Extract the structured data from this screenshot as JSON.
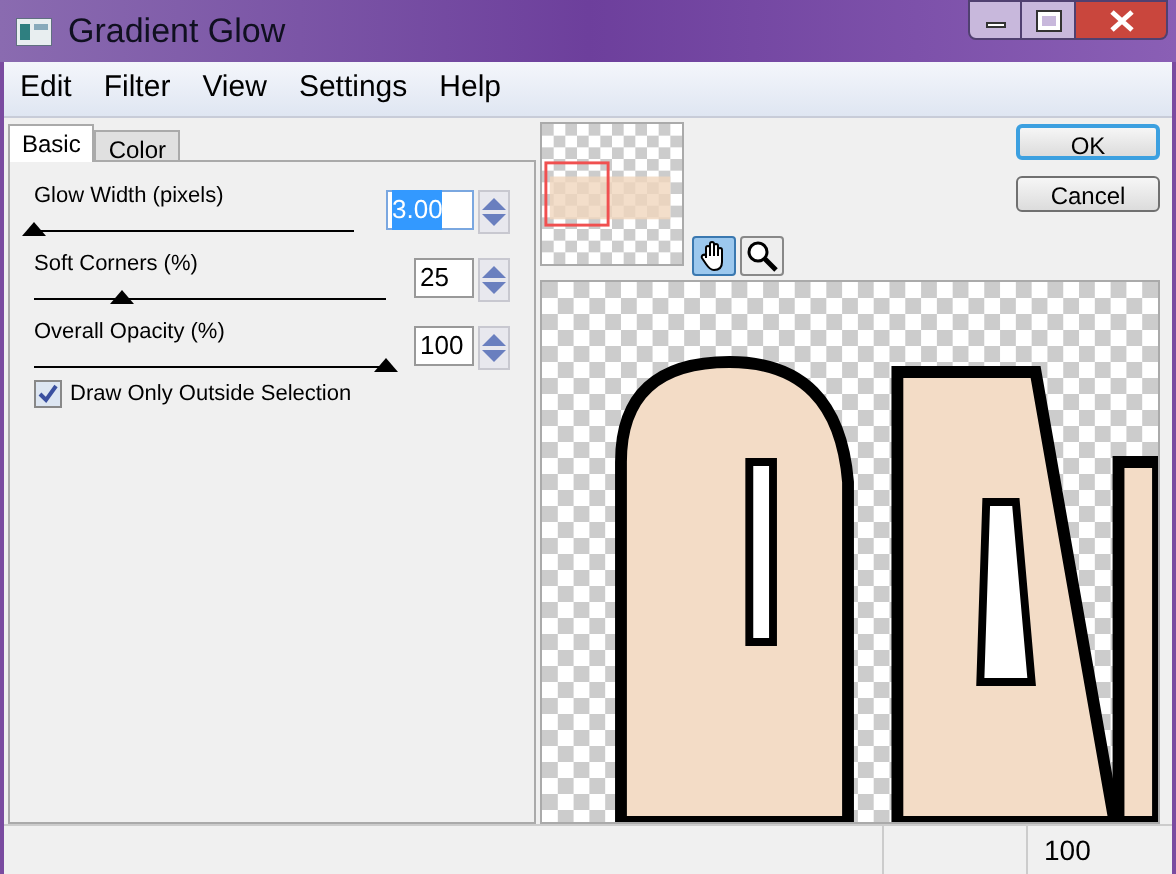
{
  "window": {
    "title": "Gradient Glow"
  },
  "menu": [
    "Edit",
    "Filter",
    "View",
    "Settings",
    "Help"
  ],
  "tabs": [
    {
      "label": "Basic",
      "selected": true
    },
    {
      "label": "Color",
      "selected": false
    }
  ],
  "sliders": [
    {
      "label": "Glow Width (pixels)",
      "value": "3.00",
      "value_selected": true,
      "level": 0
    },
    {
      "label": "Soft Corners (%)",
      "value": "25",
      "value_selected": false,
      "level": 0.25
    },
    {
      "label": "Overall Opacity (%)",
      "value": "100",
      "value_selected": false,
      "level": 1
    }
  ],
  "checkbox": {
    "label": "Draw Only Outside Selection",
    "checked": true
  },
  "tools": [
    {
      "kind": "hand",
      "selected": true
    },
    {
      "kind": "zoom",
      "selected": false
    }
  ],
  "buttons": [
    {
      "label": "OK",
      "default": true
    },
    {
      "label": "Cancel",
      "default": false
    }
  ],
  "status_bar": {
    "zoom": "100"
  }
}
